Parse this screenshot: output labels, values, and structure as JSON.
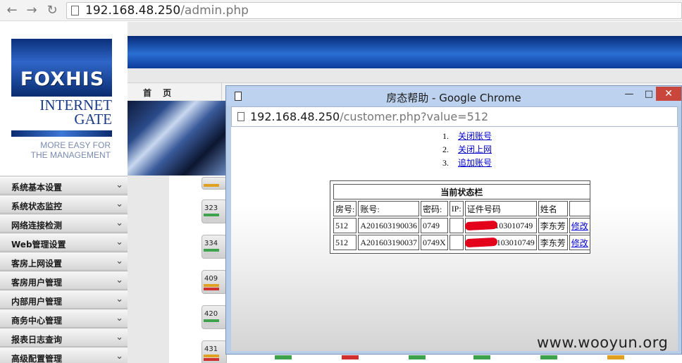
{
  "browser": {
    "url_host": "192.168.48.250",
    "url_path": "/admin.php"
  },
  "logo": {
    "brand": "FOXHIS",
    "line1": "INTERNET",
    "line2": "GATE",
    "tag1": "MORE EASY FOR",
    "tag2": "THE MANAGEMENT"
  },
  "nav": {
    "home": "首 页"
  },
  "sidebar": {
    "items": [
      {
        "label": "系统基本设置"
      },
      {
        "label": "系统状态监控"
      },
      {
        "label": "网络连接检测"
      },
      {
        "label": "Web管理设置"
      },
      {
        "label": "客房上网设置"
      },
      {
        "label": "客房用户管理"
      },
      {
        "label": "内部用户管理"
      },
      {
        "label": "商务中心管理"
      },
      {
        "label": "报表日志查询"
      },
      {
        "label": "高级配置管理"
      }
    ]
  },
  "rooms": [
    {
      "num": "323",
      "c1": "#3fa34d",
      "c2": "#d0d0d0"
    },
    {
      "num": "334",
      "c1": "#3fa34d",
      "c2": "#d0d0d0"
    },
    {
      "num": "409",
      "c1": "#e0a020",
      "c2": "#d03030"
    },
    {
      "num": "420",
      "c1": "#3fa34d",
      "c2": "#d0d0d0"
    },
    {
      "num": "431",
      "c1": "#e0a020",
      "c2": "#d03030"
    }
  ],
  "popup": {
    "title": "房态帮助 - Google Chrome",
    "url_host": "192.168.48.250",
    "url_path": "/customer.php?value=512",
    "menu": [
      {
        "idx": "1.",
        "label": "关闭账号"
      },
      {
        "idx": "2.",
        "label": "关闭上网"
      },
      {
        "idx": "3.",
        "label": "追加账号"
      }
    ],
    "table": {
      "caption": "当前状态栏",
      "headers": [
        "房号:",
        "账号:",
        "密码:",
        "IP:",
        "证件号码",
        "姓名",
        ""
      ],
      "rows": [
        {
          "room": "512",
          "account": "A201603190036",
          "password": "0749",
          "ip": "",
          "id": "199103010749",
          "id_visible_tail": "21199103010749",
          "name": "李东芳",
          "action": "修改"
        },
        {
          "room": "512",
          "account": "A201603190037",
          "password": "0749X",
          "ip": "",
          "id": "199103010749",
          "id_visible_tail": "199103010749",
          "name": "李东芳",
          "action": "修改"
        }
      ]
    }
  },
  "watermark": "www.wooyun.org"
}
